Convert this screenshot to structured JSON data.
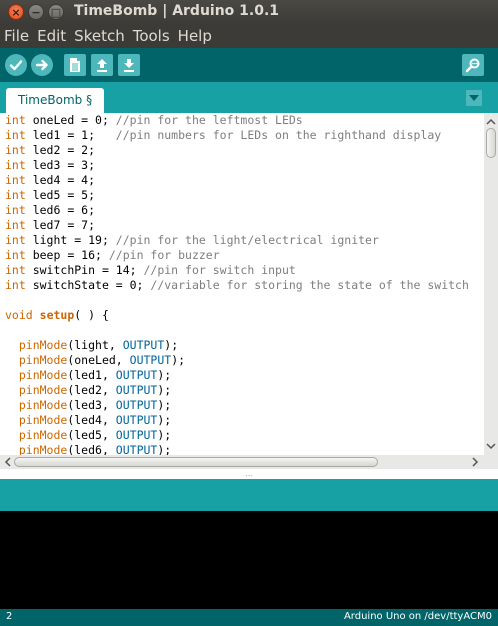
{
  "window": {
    "title": "TimeBomb | Arduino 1.0.1",
    "close_glyph": "×",
    "min_glyph": "−",
    "max_glyph": "□"
  },
  "menu": [
    "File",
    "Edit",
    "Sketch",
    "Tools",
    "Help"
  ],
  "toolbar": {
    "buttons": [
      "verify-icon",
      "upload-icon",
      "new-icon",
      "open-icon",
      "save-icon",
      "serial-monitor-icon"
    ]
  },
  "tabs": {
    "active": "TimeBomb §"
  },
  "code_lines": [
    [
      {
        "t": "int",
        "c": "kw"
      },
      {
        "t": " oneLed = 0; "
      },
      {
        "t": "//pin for the leftmost LEDs",
        "c": "cm"
      }
    ],
    [
      {
        "t": "int",
        "c": "kw"
      },
      {
        "t": " led1 = 1;   "
      },
      {
        "t": "//pin numbers for LEDs on the righthand display",
        "c": "cm"
      }
    ],
    [
      {
        "t": "int",
        "c": "kw"
      },
      {
        "t": " led2 = 2;"
      }
    ],
    [
      {
        "t": "int",
        "c": "kw"
      },
      {
        "t": " led3 = 3;"
      }
    ],
    [
      {
        "t": "int",
        "c": "kw"
      },
      {
        "t": " led4 = 4;"
      }
    ],
    [
      {
        "t": "int",
        "c": "kw"
      },
      {
        "t": " led5 = 5;"
      }
    ],
    [
      {
        "t": "int",
        "c": "kw"
      },
      {
        "t": " led6 = 6;"
      }
    ],
    [
      {
        "t": "int",
        "c": "kw"
      },
      {
        "t": " led7 = 7;"
      }
    ],
    [
      {
        "t": "int",
        "c": "kw"
      },
      {
        "t": " light = 19; "
      },
      {
        "t": "//pin for the light/electrical igniter",
        "c": "cm"
      }
    ],
    [
      {
        "t": "int",
        "c": "kw"
      },
      {
        "t": " beep = 16; "
      },
      {
        "t": "//pin for buzzer",
        "c": "cm"
      }
    ],
    [
      {
        "t": "int",
        "c": "kw"
      },
      {
        "t": " switchPin = 14; "
      },
      {
        "t": "//pin for switch input",
        "c": "cm"
      }
    ],
    [
      {
        "t": "int",
        "c": "kw"
      },
      {
        "t": " switchState = 0; "
      },
      {
        "t": "//variable for storing the state of the switch",
        "c": "cm"
      }
    ],
    [],
    [
      {
        "t": "void",
        "c": "kw"
      },
      {
        "t": " "
      },
      {
        "t": "setup",
        "c": "kwb"
      },
      {
        "t": "( ) {"
      }
    ],
    [],
    [
      {
        "t": "  "
      },
      {
        "t": "pinMode",
        "c": "kw"
      },
      {
        "t": "(light, "
      },
      {
        "t": "OUTPUT",
        "c": "const"
      },
      {
        "t": ");"
      }
    ],
    [
      {
        "t": "  "
      },
      {
        "t": "pinMode",
        "c": "kw"
      },
      {
        "t": "(oneLed, "
      },
      {
        "t": "OUTPUT",
        "c": "const"
      },
      {
        "t": ");"
      }
    ],
    [
      {
        "t": "  "
      },
      {
        "t": "pinMode",
        "c": "kw"
      },
      {
        "t": "(led1, "
      },
      {
        "t": "OUTPUT",
        "c": "const"
      },
      {
        "t": ");"
      }
    ],
    [
      {
        "t": "  "
      },
      {
        "t": "pinMode",
        "c": "kw"
      },
      {
        "t": "(led2, "
      },
      {
        "t": "OUTPUT",
        "c": "const"
      },
      {
        "t": ");"
      }
    ],
    [
      {
        "t": "  "
      },
      {
        "t": "pinMode",
        "c": "kw"
      },
      {
        "t": "(led3, "
      },
      {
        "t": "OUTPUT",
        "c": "const"
      },
      {
        "t": ");"
      }
    ],
    [
      {
        "t": "  "
      },
      {
        "t": "pinMode",
        "c": "kw"
      },
      {
        "t": "(led4, "
      },
      {
        "t": "OUTPUT",
        "c": "const"
      },
      {
        "t": ");"
      }
    ],
    [
      {
        "t": "  "
      },
      {
        "t": "pinMode",
        "c": "kw"
      },
      {
        "t": "(led5, "
      },
      {
        "t": "OUTPUT",
        "c": "const"
      },
      {
        "t": ");"
      }
    ],
    [
      {
        "t": "  "
      },
      {
        "t": "pinMode",
        "c": "kw"
      },
      {
        "t": "(led6, "
      },
      {
        "t": "OUTPUT",
        "c": "const"
      },
      {
        "t": ");"
      }
    ]
  ],
  "status": {
    "line": "2",
    "board": "Arduino Uno on /dev/ttyACM0"
  },
  "colors": {
    "toolbar_bg": "#006468",
    "tab_strip_bg": "#17a1a5",
    "button_bg": "#4db7bb",
    "keyword": "#cc6600",
    "constant": "#006699",
    "comment": "#7e7e7e"
  }
}
